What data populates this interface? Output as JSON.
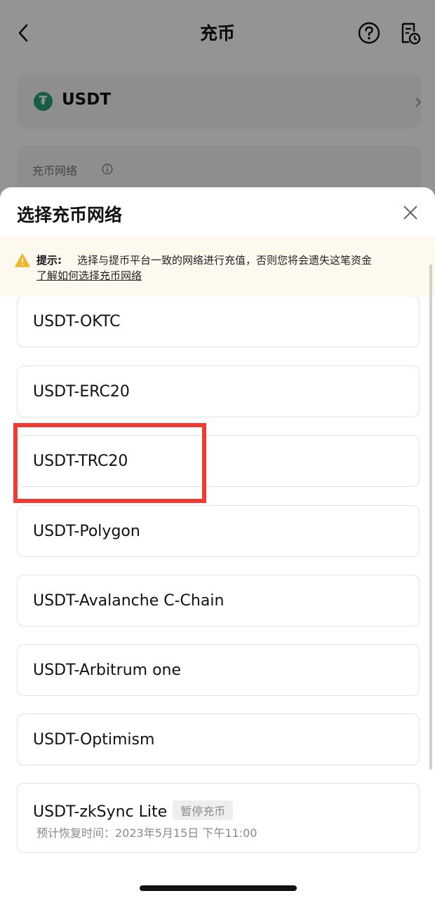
{
  "header": {
    "title": "充币"
  },
  "coin": {
    "name": "USDT",
    "logo_glyph": "₮",
    "logo_color": "#26a17b"
  },
  "network_field": {
    "label": "充币网络"
  },
  "sheet": {
    "title": "选择充币网络",
    "notice": {
      "label": "提示:",
      "text": "选择与提币平台一致的网络进行充值，否则您将会遗失这笔资金",
      "link": "了解如何选择充币网络"
    },
    "networks": [
      {
        "name": "USDT-OKTC"
      },
      {
        "name": "USDT-ERC20"
      },
      {
        "name": "USDT-TRC20",
        "highlighted": true
      },
      {
        "name": "USDT-Polygon"
      },
      {
        "name": "USDT-Avalanche C-Chain"
      },
      {
        "name": "USDT-Arbitrum one"
      },
      {
        "name": "USDT-Optimism"
      },
      {
        "name": "USDT-zkSync Lite",
        "badge": "暂停充币",
        "sub": "预计恢复时间：2023年5月15日 下午11:00"
      }
    ]
  },
  "colors": {
    "highlight": "#f03a32",
    "notice_bg": "#fdf9ee"
  }
}
